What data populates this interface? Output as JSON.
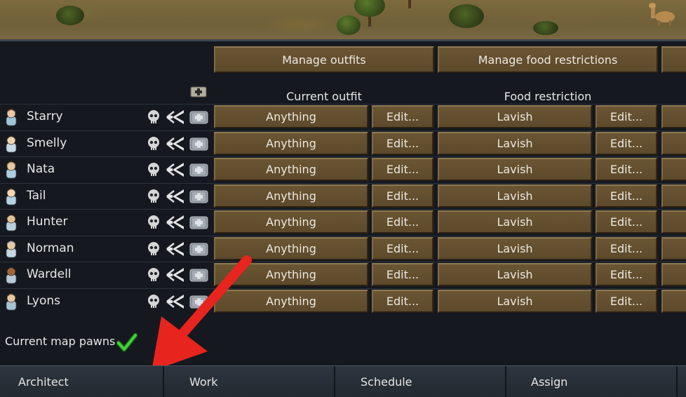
{
  "toolbar": {
    "manage_outfits": "Manage outfits",
    "manage_food": "Manage food restrictions"
  },
  "columns": {
    "outfit": "Current outfit",
    "food": "Food restriction"
  },
  "pawns": [
    {
      "name": "Starry",
      "outfit": "Anything",
      "edit_outfit": "Edit...",
      "food": "Lavish",
      "edit_food": "Edit..."
    },
    {
      "name": "Smelly",
      "outfit": "Anything",
      "edit_outfit": "Edit...",
      "food": "Lavish",
      "edit_food": "Edit..."
    },
    {
      "name": "Nata",
      "outfit": "Anything",
      "edit_outfit": "Edit...",
      "food": "Lavish",
      "edit_food": "Edit..."
    },
    {
      "name": "Tail",
      "outfit": "Anything",
      "edit_outfit": "Edit...",
      "food": "Lavish",
      "edit_food": "Edit..."
    },
    {
      "name": "Hunter",
      "outfit": "Anything",
      "edit_outfit": "Edit...",
      "food": "Lavish",
      "edit_food": "Edit..."
    },
    {
      "name": "Norman",
      "outfit": "Anything",
      "edit_outfit": "Edit...",
      "food": "Lavish",
      "edit_food": "Edit..."
    },
    {
      "name": "Wardell",
      "outfit": "Anything",
      "edit_outfit": "Edit...",
      "food": "Lavish",
      "edit_food": "Edit..."
    },
    {
      "name": "Lyons",
      "outfit": "Anything",
      "edit_outfit": "Edit...",
      "food": "Lavish",
      "edit_food": "Edit..."
    }
  ],
  "footer": {
    "current_map_pawns": "Current map pawns",
    "current_map_pawns_checked": true
  },
  "bottom_tabs": [
    {
      "label": "Architect"
    },
    {
      "label": "Work"
    },
    {
      "label": "Schedule"
    },
    {
      "label": "Assign"
    }
  ],
  "icons": {
    "row_icons": [
      "skull-icon",
      "drug-policy-icon",
      "medical-care-icon"
    ],
    "header_icon": "add-medical-icon",
    "check": "checkmark-icon",
    "annotation": "red-arrow-icon"
  },
  "colors": {
    "button": "#5d4a2b",
    "panel": "#15191f",
    "check": "#3fd13a",
    "arrow": "#e8241e"
  }
}
